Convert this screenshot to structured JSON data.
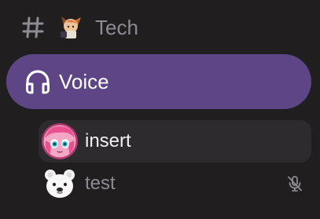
{
  "channel": {
    "icon": "hash-icon",
    "emoji": "anime-character-emoji",
    "name": "Tech"
  },
  "voice": {
    "icon": "headphones-icon",
    "label": "Voice",
    "accent_color": "#5e4585"
  },
  "members": [
    {
      "name": "insert",
      "avatar": "anime-girl-avatar",
      "active": true
    },
    {
      "name": "test",
      "avatar": "polar-bear-avatar",
      "status_icon": "mic-off-icon"
    }
  ],
  "colors": {
    "background": "#211e20",
    "muted_text": "#8f8b92",
    "active_row": "#2e2b2f"
  }
}
